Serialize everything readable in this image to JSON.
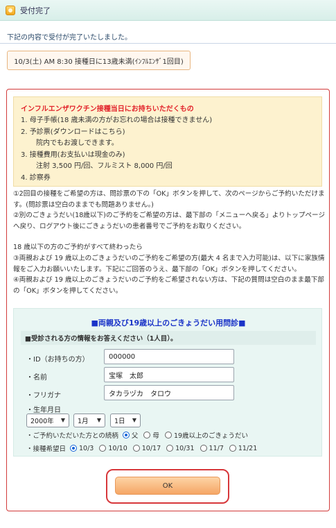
{
  "header": {
    "title": "受付完了",
    "icon": "package-icon"
  },
  "notice": "下記の内容で受付が完了いたしました。",
  "reservation": "10/3(土) AM 8:30 接種日に13歳未満(ｲﾝﾌﾙｴﾝｻﾞ1回目)",
  "info": {
    "title": "インフルエンザワクチン接種当日にお持ちいただくもの",
    "items": [
      "1. 母子手帳(18 歳未満の方がお忘れの場合は接種できません)",
      "2. 予診票(ダウンロードはこちら)",
      "院内でもお渡しできます。",
      "3. 接種費用(お支払いは現金のみ)",
      "注射 3,500 円/回、フルミスト 8,000 円/回",
      "4. 診察券"
    ]
  },
  "paragraphs": {
    "p1": "①2回目の接種をご希望の方は、問診票の下の「OK」ボタンを押して、次のページからご予約いただけます。(問診票は空白のままでも問題ありません。)",
    "p2": "②別のごきょうだい(18歳以下)のご予約をご希望の方は、最下部の「メニューへ戻る」よりトップページへ戻り、ログアウト後にごきょうだいの患者番号でご予約をお取りください。",
    "p3": "18 歳以下の方のご予約がすべて終わったら",
    "p4": "③両親および 19 歳以上のごきょうだいのご予約をご希望の方(最大 4 名まで入力可能)は、以下に家族情報をご入力お願いいたします。下記にご回答のうえ、最下部の「OK」ボタンを押してください。",
    "p5": "④両親および 19 歳以上のごきょうだいのご予約をご希望されない方は、下記の質問は空白のまま最下部の「OK」ボタンを押してください。"
  },
  "form": {
    "title": "■両親及び19歳以上のごきょうだい用問診■",
    "subtitle": "■受診される方の情報をお答えください（1人目）。",
    "id_label": "・ID（お持ちの方）",
    "id_value": "000000",
    "name_label": "・名前",
    "name_value": "宝塚　太郎",
    "kana_label": "・フリガナ",
    "kana_value": "タカラヅカ　タロウ",
    "birth_label": "・生年月日",
    "year": "2000年",
    "month": "1月",
    "day": "1日",
    "relation_label": "・ご予約いただいた方との続柄",
    "relations": [
      "父",
      "母",
      "19歳以上のごきょうだい"
    ],
    "date_label": "・接種希望日",
    "dates": [
      "10/3",
      "10/10",
      "10/17",
      "10/31",
      "11/7",
      "11/21"
    ]
  },
  "ok_label": "OK"
}
